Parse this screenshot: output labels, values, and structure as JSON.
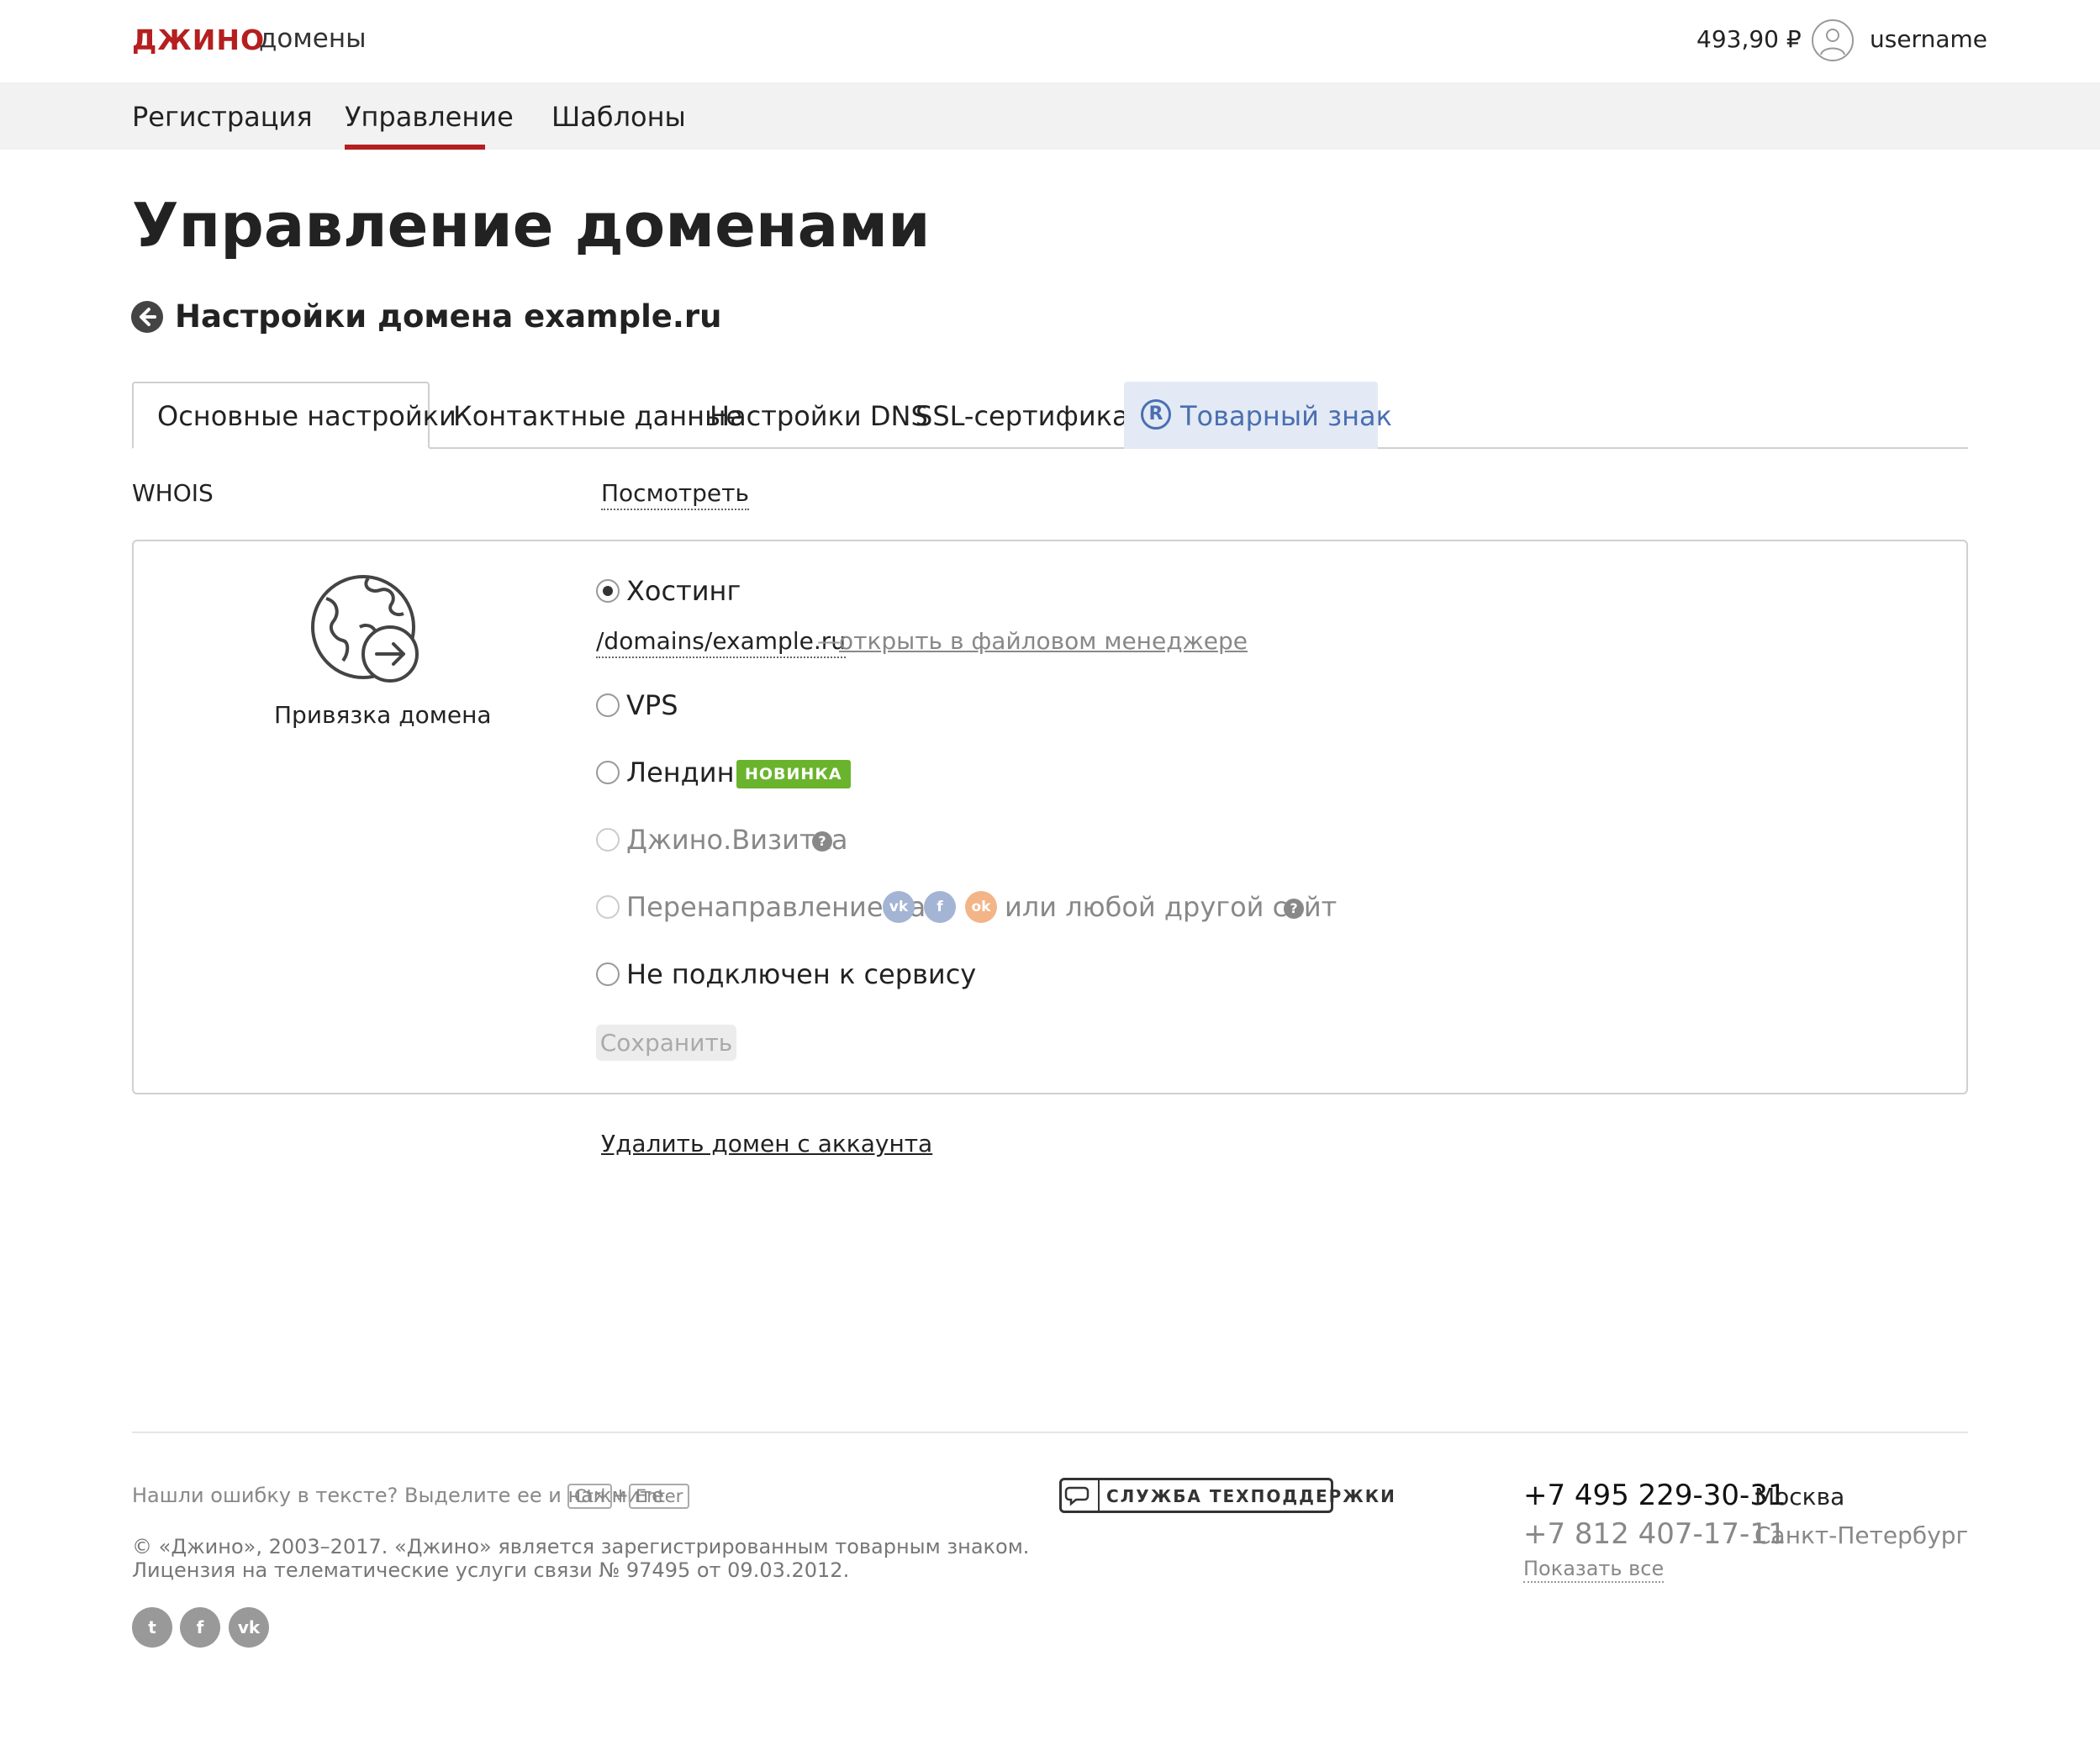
{
  "header": {
    "logo": "ДЖИНО",
    "logo_sub": "домены",
    "balance": "493,90 ₽",
    "username": "username"
  },
  "nav": {
    "items": [
      {
        "label": "Регистрация"
      },
      {
        "label": "Управление",
        "active": true
      },
      {
        "label": "Шаблоны"
      }
    ],
    "accent_color": "#b51f1f"
  },
  "page": {
    "title": "Управление доменами",
    "subtitle": "Настройки домена example.ru"
  },
  "tabs": [
    {
      "label": "Основные настройки",
      "active": true
    },
    {
      "label": "Контактные данные"
    },
    {
      "label": "Настройки DNS"
    },
    {
      "label": "SSL-сертификат"
    },
    {
      "label": "Товарный знак",
      "icon": "registered-icon",
      "highlight": true
    }
  ],
  "whois": {
    "label": "WHOIS",
    "link": "Посмотреть"
  },
  "binding": {
    "label": "Привязка домена",
    "icon": "globe-arrow-icon",
    "options": [
      {
        "label": "Хостинг",
        "checked": true
      },
      {
        "label": "VPS"
      },
      {
        "label": "Лендинг",
        "badge": "НОВИНКА"
      },
      {
        "label": "Джино.Визитка",
        "disabled": true
      },
      {
        "label_before": "Перенаправление на",
        "label_after": "или любой другой сайт",
        "disabled": true,
        "socials": [
          "vk",
          "facebook",
          "odnoklassniki"
        ]
      },
      {
        "label": "Не подключен к сервису"
      }
    ],
    "hosting_path": "/domains/example.ru",
    "hosting_dash": "—",
    "hosting_link": "открыть в файловом менеджере",
    "save_label": "Сохранить",
    "help_glyph": "?"
  },
  "delete_link": "Удалить домен с аккаунта",
  "footer": {
    "error_text": "Нашли ошибку в тексте? Выделите ее и нажмите",
    "key_ctrl": "Ctrl",
    "plus": "+",
    "key_enter": "Enter",
    "copyright_line1": "© «Джино», 2003–2017. «Джино» является зарегистрированным товарным знаком.",
    "copyright_line2": "Лицензия на телематические услуги связи № 97495 от 09.03.2012.",
    "support_label": "СЛУЖБА ТЕХПОДДЕРЖКИ",
    "phones": [
      {
        "number": "+7 495 229-30-31",
        "city": "Москва"
      },
      {
        "number": "+7 812 407-17-11",
        "city": "Санкт-Петербург"
      }
    ],
    "show_all": "Показать все",
    "socials": [
      "twitter",
      "facebook",
      "vk"
    ]
  }
}
